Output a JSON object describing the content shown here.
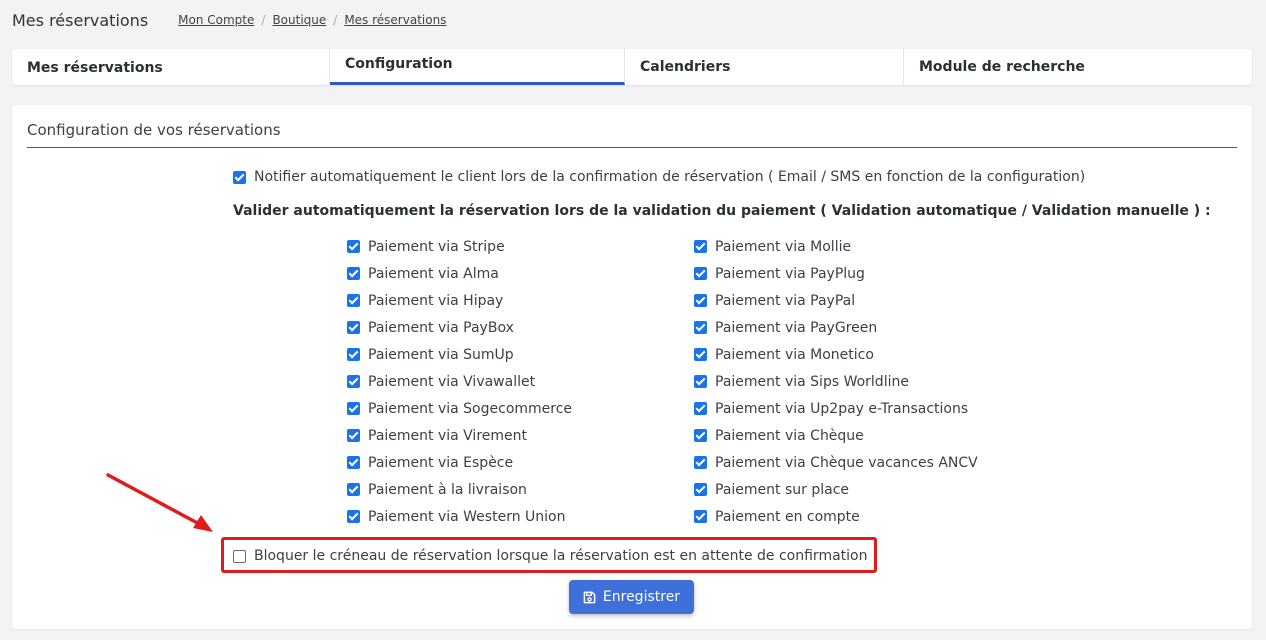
{
  "header": {
    "title": "Mes réservations",
    "breadcrumb": [
      "Mon Compte",
      "Boutique",
      "Mes réservations"
    ]
  },
  "tabs": [
    {
      "label": "Mes réservations",
      "active": false
    },
    {
      "label": "Configuration",
      "active": true
    },
    {
      "label": "Calendriers",
      "active": false
    },
    {
      "label": "Module de recherche",
      "active": false
    }
  ],
  "card": {
    "title": "Configuration de vos réservations",
    "notify_label": "Notifier automatiquement le client lors de la confirmation de réservation ( Email / SMS en fonction de la configuration)",
    "notify_checked": true,
    "validate_heading": "Valider automatiquement la réservation lors de la validation du paiement ( Validation automatique / Validation manuelle ) :",
    "payments_left": [
      {
        "label": "Paiement via Stripe",
        "checked": true
      },
      {
        "label": "Paiement via Alma",
        "checked": true
      },
      {
        "label": "Paiement via Hipay",
        "checked": true
      },
      {
        "label": "Paiement via PayBox",
        "checked": true
      },
      {
        "label": "Paiement via SumUp",
        "checked": true
      },
      {
        "label": "Paiement via Vivawallet",
        "checked": true
      },
      {
        "label": "Paiement via Sogecommerce",
        "checked": true
      },
      {
        "label": "Paiement via Virement",
        "checked": true
      },
      {
        "label": "Paiement via Espèce",
        "checked": true
      },
      {
        "label": "Paiement à la livraison",
        "checked": true
      },
      {
        "label": "Paiement via Western Union",
        "checked": true
      }
    ],
    "payments_right": [
      {
        "label": "Paiement via Mollie",
        "checked": true
      },
      {
        "label": "Paiement via PayPlug",
        "checked": true
      },
      {
        "label": "Paiement via PayPal",
        "checked": true
      },
      {
        "label": "Paiement via PayGreen",
        "checked": true
      },
      {
        "label": "Paiement via Monetico",
        "checked": true
      },
      {
        "label": "Paiement via Sips Worldline",
        "checked": true
      },
      {
        "label": "Paiement via Up2pay e-Transactions",
        "checked": true
      },
      {
        "label": "Paiement via Chèque",
        "checked": true
      },
      {
        "label": "Paiement via Chèque vacances ANCV",
        "checked": true
      },
      {
        "label": "Paiement sur place",
        "checked": true
      },
      {
        "label": "Paiement en compte",
        "checked": true
      }
    ],
    "block_label": "Bloquer le créneau de réservation lorsque la réservation est en attente de confirmation",
    "block_checked": false,
    "save_label": "Enregistrer"
  },
  "colors": {
    "accent": "#2e58c8",
    "checkbox": "#1a73e8",
    "button": "#3f6fd8",
    "annotation": "#e01b1b"
  }
}
